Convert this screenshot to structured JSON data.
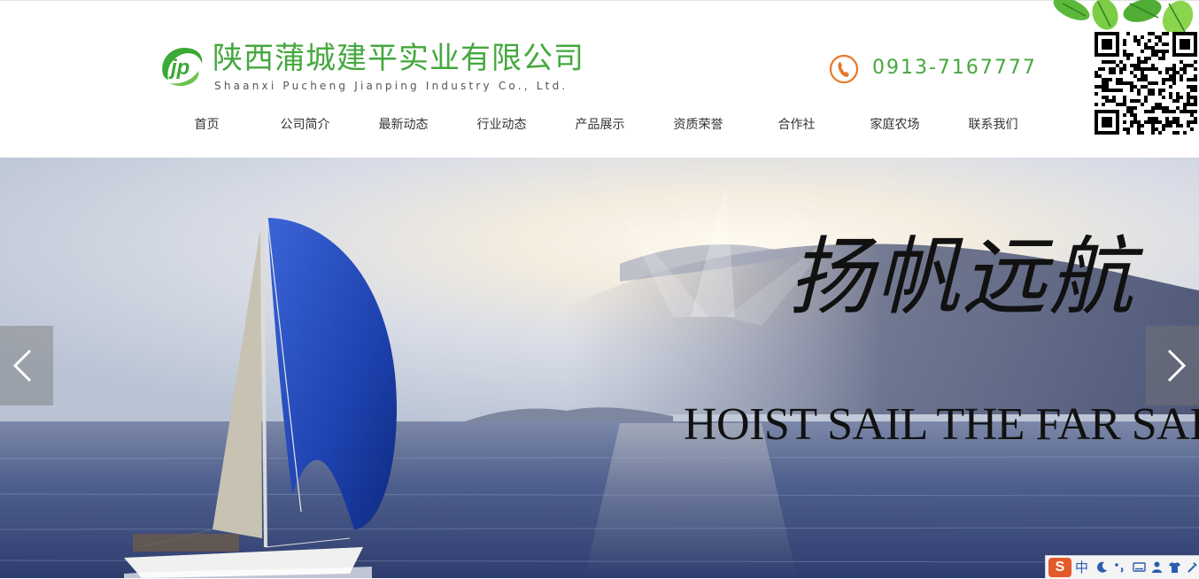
{
  "header": {
    "company_name_cn": "陕西蒲城建平实业有限公司",
    "company_name_en": "Shaanxi Pucheng Jianping Industry Co., Ltd.",
    "phone": "0913-7167777"
  },
  "nav": {
    "items": [
      {
        "label": "首页"
      },
      {
        "label": "公司简介"
      },
      {
        "label": "最新动态"
      },
      {
        "label": "行业动态"
      },
      {
        "label": "产品展示"
      },
      {
        "label": "资质荣誉"
      },
      {
        "label": "合作社"
      },
      {
        "label": "家庭农场"
      },
      {
        "label": "联系我们"
      }
    ]
  },
  "banner": {
    "slogan_cn": "扬帆远航",
    "slogan_en": "HOIST SAIL THE FAR SAIL"
  },
  "ime": {
    "logo": "S",
    "lang": "中"
  },
  "colors": {
    "brand_green": "#45a83e",
    "phone_orange": "#e8762a",
    "sail_blue": "#1f45b8"
  },
  "icons": [
    "logo-jp-icon",
    "phone-icon",
    "qr-code",
    "arrow-left-icon",
    "arrow-right-icon"
  ]
}
